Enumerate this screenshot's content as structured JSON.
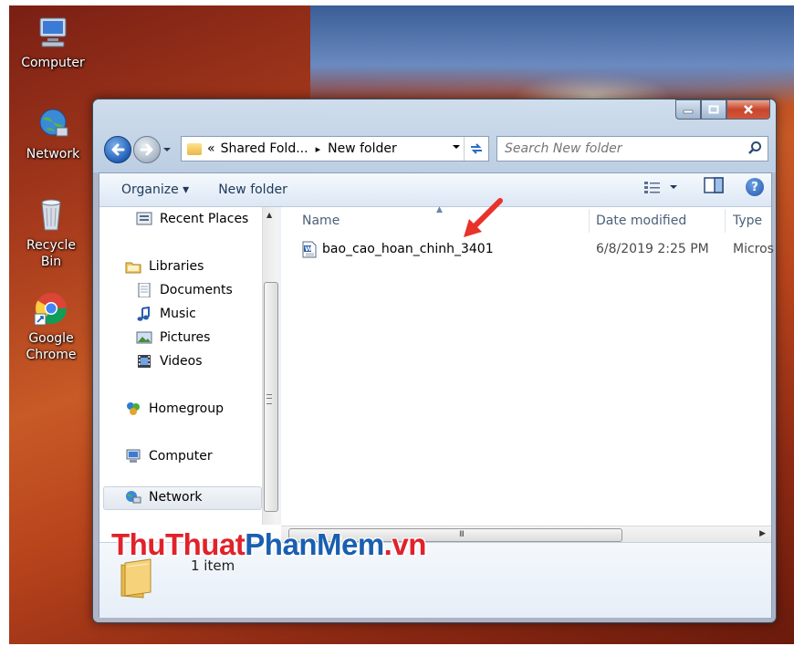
{
  "desktop": {
    "icons": [
      {
        "label": "Computer",
        "icon": "computer-icon"
      },
      {
        "label": "Network",
        "icon": "network-globe-icon"
      },
      {
        "label": "Recycle Bin",
        "icon": "recycle-bin-icon"
      },
      {
        "label_line1": "Google",
        "label_line2": "Chrome",
        "icon": "chrome-icon"
      }
    ]
  },
  "window": {
    "caption_buttons": {
      "minimize": "minimize-icon",
      "maximize": "maximize-icon",
      "close": "close-icon"
    },
    "address": {
      "prefix": "«",
      "crumb1": "Shared Fold...",
      "separator": "▸",
      "crumb2": "New folder"
    },
    "search": {
      "placeholder": "Search New folder"
    },
    "toolbar": {
      "organize": "Organize ▾",
      "new_folder": "New folder"
    },
    "nav": {
      "recent_places": "Recent Places",
      "libraries": "Libraries",
      "documents": "Documents",
      "music": "Music",
      "pictures": "Pictures",
      "videos": "Videos",
      "homegroup": "Homegroup",
      "computer": "Computer",
      "network": "Network"
    },
    "columns": {
      "name": "Name",
      "date_modified": "Date modified",
      "type": "Type"
    },
    "files": [
      {
        "name": "bao_cao_hoan_chinh_3401",
        "date_modified": "6/8/2019 2:25 PM",
        "type": "Micros"
      }
    ],
    "details": {
      "item_count": "1 item"
    },
    "scrollbar_grip": "III"
  },
  "watermark": {
    "part1": "ThuThuat",
    "part2": "PhanMem",
    "part3": ".vn"
  },
  "colors": {
    "accent": "#1f5fb8",
    "close": "#c7452b",
    "watermark_red": "#e0222a",
    "watermark_blue": "#1a5fb0"
  }
}
